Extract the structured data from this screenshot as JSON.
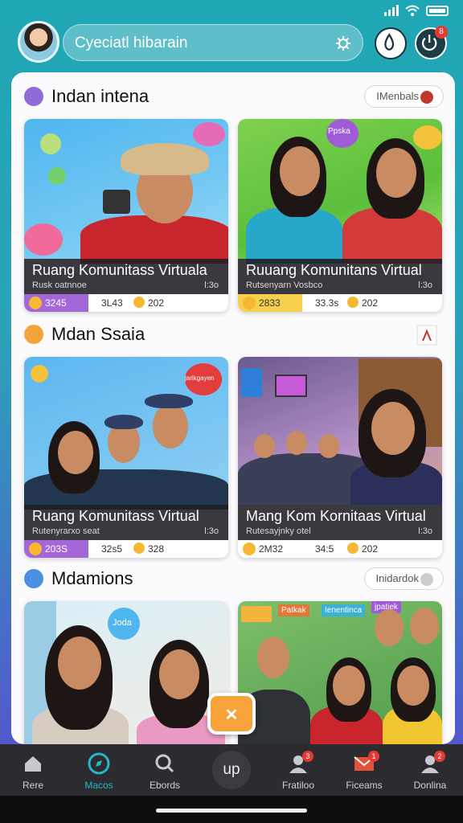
{
  "header": {
    "search_text": "Cyeciatl hibarain",
    "notif_badge": "8"
  },
  "sections": [
    {
      "title": "Indan intena",
      "pill": "IMenbals",
      "cards": [
        {
          "title": "Ruang Komunitass Virtuala",
          "subtitle": "Rusk oatnnoe",
          "mini": "l:3o",
          "stat1": "3245",
          "stat2": "3L43",
          "stat3": "202"
        },
        {
          "title": "Ruuang Komunitans Virtual",
          "subtitle": "Rutsenyarn Vosbco",
          "mini": "l:3o",
          "stat1": "2833",
          "stat2": "33.3s",
          "stat3": "202"
        }
      ]
    },
    {
      "title": "Mdan Ssaia",
      "pill": "",
      "cards": [
        {
          "title": "Ruang Komunitass Virtual",
          "subtitle": "Rutenyrarxo seat",
          "mini": "l:3o",
          "stat1": "203S",
          "stat2": "32s5",
          "stat3": "328"
        },
        {
          "title": "Mang Kom Kornitaas Virtual",
          "subtitle": "Rutesayjnky otel",
          "mini": "l:3o",
          "stat1": "2M32",
          "stat2": "34:5",
          "stat3": "202"
        }
      ]
    },
    {
      "title": "Mdamions",
      "pill": "Inidardok",
      "cards": []
    }
  ],
  "card_bubbles": {
    "c2": "Ppska",
    "c3": "jarlkgayen",
    "c5": "Joda",
    "c6a": "Patkak",
    "c6b": "Ienentinca",
    "c6c": "jpatjek"
  },
  "fab_label": "✕",
  "nav": {
    "items": [
      {
        "label": "Rere",
        "badge": ""
      },
      {
        "label": "Macos",
        "badge": ""
      },
      {
        "label": "Ebords",
        "badge": ""
      },
      {
        "label": "Fratiloo",
        "badge": "3"
      },
      {
        "label": "Ficeams",
        "badge": "1"
      },
      {
        "label": "Donlina",
        "badge": "2"
      }
    ],
    "center": "up"
  },
  "colors": {
    "accent_purple": "#8e4fd1",
    "accent_yellow": "#f6d04d",
    "badge_red": "#e53935"
  }
}
